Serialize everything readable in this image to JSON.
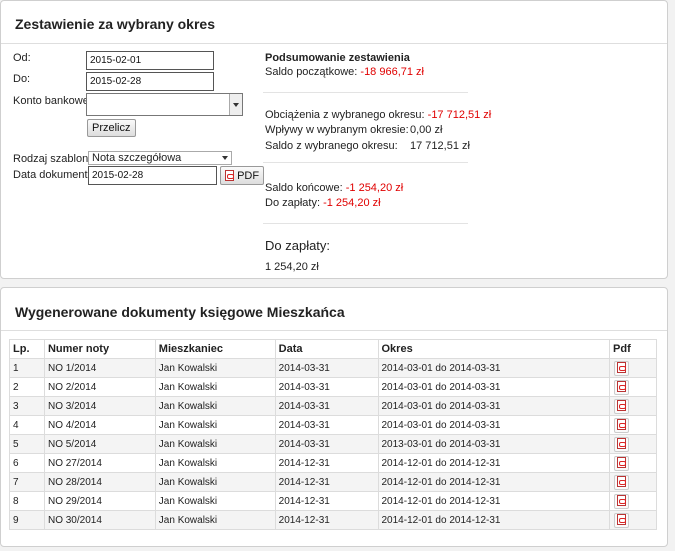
{
  "summary_panel": {
    "title": "Zestawienie za wybrany okres",
    "form": {
      "from_label": "Od:",
      "from_value": "2015-02-01",
      "to_label": "Do:",
      "to_value": "2015-02-28",
      "account_label": "Konto bankowe:",
      "account_value": "",
      "recalc_button": "Przelicz",
      "template_label": "Rodzaj szablonu:",
      "template_value": "Nota szczegółowa",
      "doc_date_label": "Data dokumentu:",
      "doc_date_value": "2015-02-28",
      "pdf_button": "PDF"
    },
    "summary": {
      "heading": "Podsumowanie zestawienia",
      "opening_label": "Saldo początkowe:",
      "opening_value": "-18 966,71 zł",
      "charges_label": "Obciążenia z wybranego okresu:",
      "charges_value": "-17 712,51 zł",
      "payments_label": "Wpływy w wybranym okresie:",
      "payments_value": "0,00 zł",
      "period_balance_label": "Saldo z wybranego okresu:",
      "period_balance_value": "17 712,51 zł",
      "closing_label": "Saldo końcowe:",
      "closing_value": "-1 254,20 zł",
      "to_pay_label": "Do zapłaty:",
      "to_pay_value": "-1 254,20 zł",
      "big_to_pay_label": "Do zapłaty:",
      "big_to_pay_value": "1 254,20 zł"
    }
  },
  "documents_panel": {
    "title": "Wygenerowane dokumenty księgowe Mieszkańca",
    "columns": [
      "Lp.",
      "Numer noty",
      "Mieszkaniec",
      "Data",
      "Okres",
      "Pdf"
    ],
    "rows": [
      {
        "lp": "1",
        "number": "NO 1/2014",
        "resident": "Jan Kowalski",
        "date": "2014-03-31",
        "period": "2014-03-01 do 2014-03-31"
      },
      {
        "lp": "2",
        "number": "NO 2/2014",
        "resident": "Jan Kowalski",
        "date": "2014-03-31",
        "period": "2014-03-01 do 2014-03-31"
      },
      {
        "lp": "3",
        "number": "NO 3/2014",
        "resident": "Jan Kowalski",
        "date": "2014-03-31",
        "period": "2014-03-01 do 2014-03-31"
      },
      {
        "lp": "4",
        "number": "NO 4/2014",
        "resident": "Jan Kowalski",
        "date": "2014-03-31",
        "period": "2014-03-01 do 2014-03-31"
      },
      {
        "lp": "5",
        "number": "NO 5/2014",
        "resident": "Jan Kowalski",
        "date": "2014-03-31",
        "period": "2013-03-01 do 2014-03-31"
      },
      {
        "lp": "6",
        "number": "NO 27/2014",
        "resident": "Jan Kowalski",
        "date": "2014-12-31",
        "period": "2014-12-01 do 2014-12-31"
      },
      {
        "lp": "7",
        "number": "NO 28/2014",
        "resident": "Jan Kowalski",
        "date": "2014-12-31",
        "period": "2014-12-01 do 2014-12-31"
      },
      {
        "lp": "8",
        "number": "NO 29/2014",
        "resident": "Jan Kowalski",
        "date": "2014-12-31",
        "period": "2014-12-01 do 2014-12-31"
      },
      {
        "lp": "9",
        "number": "NO 30/2014",
        "resident": "Jan Kowalski",
        "date": "2014-12-31",
        "period": "2014-12-01 do 2014-12-31"
      }
    ]
  },
  "colors": {
    "negative": "#e00000"
  },
  "icons": {
    "pdf": "pdf-file-icon"
  }
}
